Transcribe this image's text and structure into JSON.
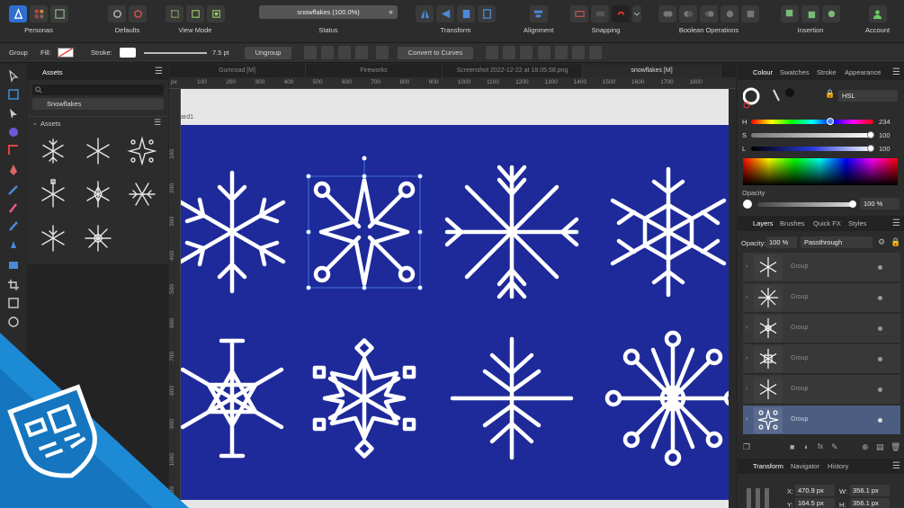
{
  "toolbar": {
    "personas": "Personas",
    "defaults": "Defaults",
    "view_mode": "View Mode",
    "status": "Status",
    "status_value": "snowflakes (100.0%)",
    "transform": "Transform",
    "alignment": "Alignment",
    "snapping": "Snapping",
    "boolean": "Boolean Operations",
    "insertion": "Insertion",
    "account": "Account"
  },
  "context": {
    "group": "Group",
    "fill": "Fill:",
    "stroke": "Stroke:",
    "stroke_width": "7.5 pt",
    "ungroup": "Ungroup",
    "convert": "Convert to Curves"
  },
  "assets": {
    "tab": "Assets",
    "dropdown": "Snowflakes",
    "section": "Assets"
  },
  "doc_tabs": [
    "Gumroad [M]",
    "Fireworks",
    "Screenshot 2022-12-22 at 18.05.58.png",
    "snowflakes [M]"
  ],
  "ruler": {
    "unit": "px",
    "top": [
      "100",
      "200",
      "300",
      "400",
      "500",
      "600",
      "700",
      "800",
      "900",
      "1000",
      "1100",
      "1200",
      "1300",
      "1400",
      "1500",
      "1600",
      "1700",
      "1800"
    ],
    "left": [
      "100",
      "200",
      "300",
      "400",
      "500",
      "600",
      "700",
      "800",
      "900",
      "1000",
      "1100"
    ],
    "artboard_label": "ard1"
  },
  "colour": {
    "tabs": [
      "Colour",
      "Swatches",
      "Stroke",
      "Appearance"
    ],
    "model": "HSL",
    "h_label": "H",
    "h_value": "234",
    "s_label": "S",
    "s_value": "100",
    "l_label": "L",
    "l_value": "100",
    "opacity_label": "Opacity",
    "opacity_value": "100 %"
  },
  "layers": {
    "tabs": [
      "Layers",
      "Brushes",
      "Quick FX",
      "Styles"
    ],
    "opacity_label": "Opacity:",
    "opacity_value": "100 %",
    "blend": "Passthrough",
    "rows": [
      "Group",
      "Group",
      "Group",
      "Group",
      "Group",
      "Group"
    ]
  },
  "transform": {
    "tabs": [
      "Transform",
      "Navigator",
      "History"
    ],
    "x_label": "X:",
    "x_value": "470.9 px",
    "y_label": "Y:",
    "y_value": "164.5 px",
    "w_label": "W:",
    "w_value": "356.1 px",
    "h_label": "H:",
    "h_value": "356.1 px"
  },
  "colors": {
    "artboard": "#1e2a9a",
    "accent": "#4b5d80",
    "selection": "#3d7bdc"
  }
}
